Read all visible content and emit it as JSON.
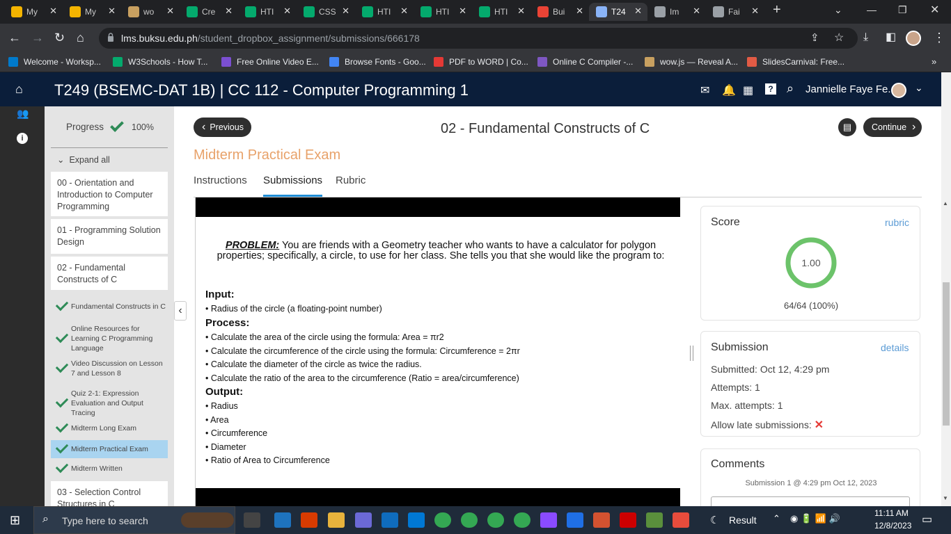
{
  "browser": {
    "tabs": [
      {
        "title": "My",
        "icon": "google-drive-icon",
        "color": "#f4b400"
      },
      {
        "title": "My",
        "icon": "google-drive-icon",
        "color": "#f4b400"
      },
      {
        "title": "wo",
        "icon": "image-icon",
        "color": "#c8a060"
      },
      {
        "title": "Cre",
        "icon": "w3schools-icon",
        "color": "#04aa6d"
      },
      {
        "title": "HTI",
        "icon": "w3schools-icon",
        "color": "#04aa6d"
      },
      {
        "title": "CSS",
        "icon": "w3schools-icon",
        "color": "#04aa6d"
      },
      {
        "title": "HTI",
        "icon": "w3schools-icon",
        "color": "#04aa6d"
      },
      {
        "title": "HTI",
        "icon": "w3schools-icon",
        "color": "#04aa6d"
      },
      {
        "title": "HTI",
        "icon": "w3schools-icon",
        "color": "#04aa6d"
      },
      {
        "title": "Bui",
        "icon": "gmail-icon",
        "color": "#ea4335"
      },
      {
        "title": "T24",
        "icon": "lms-icon",
        "color": "#8ab4f8",
        "active": true
      },
      {
        "title": "Im",
        "icon": "globe-icon",
        "color": "#9aa0a6"
      },
      {
        "title": "Fai",
        "icon": "globe-icon",
        "color": "#9aa0a6"
      }
    ],
    "url_domain": "lms.buksu.edu.ph",
    "url_path": "/student_dropbox_assignment/submissions/666178",
    "bookmarks": [
      {
        "label": "Welcome - Worksp...",
        "color": "#007acc"
      },
      {
        "label": "W3Schools - How T...",
        "color": "#04aa6d"
      },
      {
        "label": "Free Online Video E...",
        "color": "#7b4fd1"
      },
      {
        "label": "Browse Fonts - Goo...",
        "color": "#4285f4"
      },
      {
        "label": "PDF to WORD | Co...",
        "color": "#e53935"
      },
      {
        "label": "Online C Compiler -...",
        "color": "#7e57c2"
      },
      {
        "label": "wow.js — Reveal A...",
        "color": "#c8a060"
      },
      {
        "label": "SlidesCarnival: Free...",
        "color": "#e25b45"
      }
    ]
  },
  "header": {
    "course_title": "T249 (BSEMC-DAT 1B) | CC 112 - Computer Programming 1",
    "user_name": "Jannielle Faye Fe..."
  },
  "nav": {
    "progress_label": "Progress",
    "progress_value": "100%",
    "expand_all": "Expand all",
    "units": [
      "00 - Orientation and Introduction to Computer Programming",
      "01 - Programming Solution Design",
      "02 - Fundamental Constructs of C"
    ],
    "items": [
      "Fundamental Constructs in C",
      "Online Resources for Learning C Programming Language",
      "Video Discussion on Lesson 7 and Lesson 8",
      "Quiz 2-1: Expression Evaluation and Output Tracing",
      "Midterm Long Exam",
      "Midterm Practical Exam",
      "Midterm Written"
    ],
    "next_unit": "03 - Selection Control Structures in C"
  },
  "main": {
    "previous": "Previous",
    "module_title": "02 - Fundamental Constructs of C",
    "continue": "Continue",
    "assignment_title": "Midterm Practical Exam",
    "tabs": [
      "Instructions",
      "Submissions",
      "Rubric"
    ],
    "active_tab": "Submissions"
  },
  "document": {
    "problem_label": "PROBLEM:",
    "problem_text": " You are friends with a Geometry teacher who wants to have a calculator for polygon properties; specifically, a circle, to use for her class. She tells you that she would like the program to:",
    "input_heading": "Input:",
    "input_items": [
      "Radius of the circle (a floating-point number)"
    ],
    "process_heading": "Process:",
    "process_items": [
      "Calculate the area of the circle using the formula: Area = πr2",
      "Calculate the circumference of the circle using the formula: Circumference = 2πr",
      "Calculate the diameter of the circle as twice the radius.",
      "Calculate the ratio of the area to the circumference (Ratio = area/circumference)"
    ],
    "output_heading": "Output:",
    "output_items": [
      "Radius",
      "Area",
      "Circumference",
      "Diameter",
      "Ratio of Area to Circumference"
    ]
  },
  "score": {
    "heading": "Score",
    "link": "rubric",
    "value": "1.00",
    "ratio": 1.0,
    "detail": "64/64 (100%)"
  },
  "submission": {
    "heading": "Submission",
    "link": "details",
    "submitted": "Submitted: Oct 12, 4:29 pm",
    "attempts": "Attempts: 1",
    "max_attempts": "Max. attempts: 1",
    "late": "Allow late submissions:"
  },
  "comments": {
    "heading": "Comments",
    "sub": "Submission 1 @ 4:29 pm Oct 12, 2023"
  },
  "taskbar": {
    "search_placeholder": "Type here to search",
    "result": "Result",
    "time": "11:11 AM",
    "date": "12/8/2023"
  },
  "colors": {
    "accent": "#2e8b57",
    "header": "#0b1e3a",
    "assignment_title": "#e8a26a",
    "tab_underline": "#1f8dd6",
    "link": "#5b9bd5"
  }
}
